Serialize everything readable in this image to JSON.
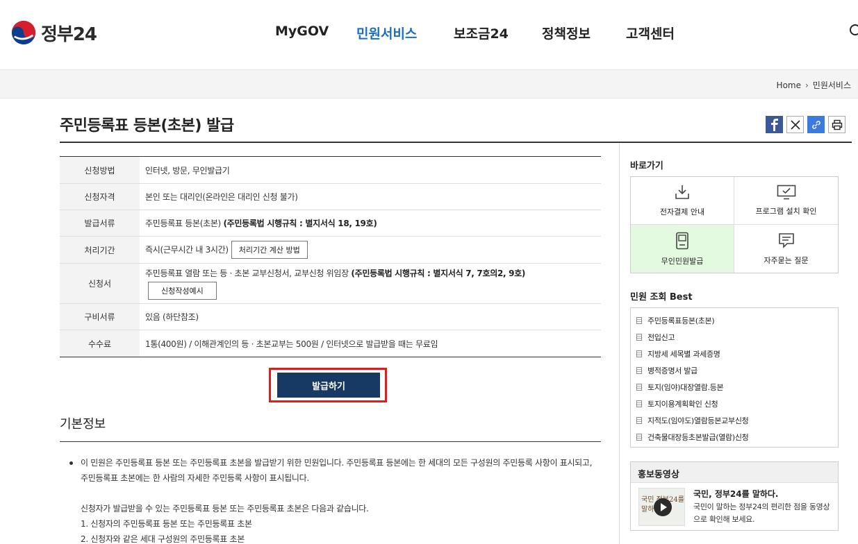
{
  "header": {
    "logo_text": "정부24",
    "nav": [
      {
        "label": "MyGOV"
      },
      {
        "label": "민원서비스"
      },
      {
        "label": "보조금24"
      },
      {
        "label": "정책정보"
      },
      {
        "label": "고객센터"
      }
    ],
    "active_nav": "민원서비스"
  },
  "breadcrumb": {
    "home": "Home",
    "current": "민원서비스"
  },
  "page": {
    "title": "주민등록표 등본(초본) 발급"
  },
  "info": {
    "rows": [
      {
        "label": "신청방법",
        "value": "인터넷, 방문, 무인발급기"
      },
      {
        "label": "신청자격",
        "value": "본인 또는 대리인(온라인은 대리인 신청 불가)"
      },
      {
        "label": "발급서류",
        "value": "주민등록표 등본(초본) ",
        "bold": "(주민등록법 시행규칙 : 별지서식 18, 19호)"
      },
      {
        "label": "처리기간",
        "value": "즉시(근무시간 내 3시간)",
        "button": "처리기간 계산 방법"
      },
      {
        "label": "신청서",
        "value": "주민등록표 열람 또는 등 · 초본 교부신청서, 교부신청 위임장 ",
        "bold": "(주민등록법 시행규칙 : 별지서식 7, 7호의2, 9호)",
        "button": "신청작성예시"
      },
      {
        "label": "구비서류",
        "value": "있음 (하단참조)"
      },
      {
        "label": "수수료",
        "value": "1통(400원) / 이해관계인의 등 · 초본교부는 500원 / 인터넷으로 발급받을 때는 무료임"
      }
    ]
  },
  "issue_button": "발급하기",
  "basic_info": {
    "title": "기본정보",
    "bullet": "이 민원은 주민등록표 등본 또는 주민등록표 초본을 발급받기 위한 민원입니다. 주민등록표 등본에는 한 세대의 모든 구성원의 주민등록 사항이 표시되고, 주민등록표 초본에는 한 사람의 자세한 주민등록 사항이 표시됩니다.",
    "para": "신청자가 발급받을 수 있는 주민등록표 등본 또는 주민등록표 초본은 다음과 같습니다.",
    "item1": "1. 신청자의 주민등록표 등본 또는 주민등록표 초본",
    "item2": "2. 신청자와 같은 세대 구성원의 주민등록표 초본"
  },
  "sidebar": {
    "quick_title": "바로가기",
    "quick": [
      {
        "label": "전자결제 안내",
        "icon": "download-icon"
      },
      {
        "label": "프로그램 설치 확인",
        "icon": "monitor-check-icon"
      },
      {
        "label": "무인민원발급",
        "icon": "kiosk-icon"
      },
      {
        "label": "자주묻는 질문",
        "icon": "chat-icon"
      }
    ],
    "best_title": "민원 조회 Best",
    "best": [
      "주민등록표등본(초본)",
      "전입신고",
      "지방세 세목별 과세증명",
      "병적증명서 발급",
      "토지(임야)대장열람.등본",
      "토지이용계획확인 신청",
      "지적도(임야도)열람등본교부신청",
      "건축물대장등초본발급(열람)신청"
    ],
    "video_title": "홍보동영상",
    "video_heading": "국민, 정부24를 말하다.",
    "video_desc": "국민이 말하는 정부24의 편리한 점을 동영상으로 확인해 보세요.",
    "video_thumb_text": "국민 정부24를 말하다"
  },
  "colors": {
    "accent": "#1a6ec0",
    "issue_button": "#163a63",
    "highlight": "#e31b1b",
    "quick_highlight": "#e3fae0"
  }
}
